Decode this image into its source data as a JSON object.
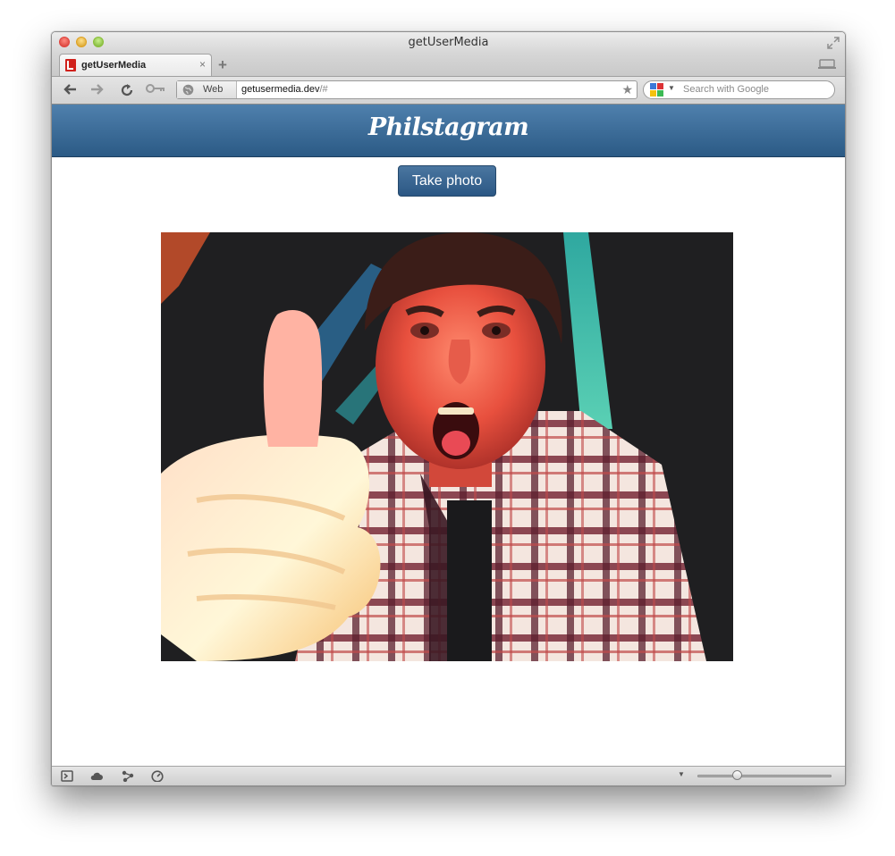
{
  "window": {
    "title": "getUserMedia",
    "traffic_lights": {
      "close_color": "#e0443e",
      "minimize_color": "#dea123",
      "zoom_color": "#8bbf3a"
    },
    "fullscreen_icon": "fullscreen-arrows-icon"
  },
  "tabs": [
    {
      "title": "getUserMedia",
      "favicon": "red-document-favicon",
      "close_glyph": "×"
    }
  ],
  "new_tab_glyph": "+",
  "toolbar": {
    "back_icon": "back-arrow-icon",
    "forward_icon": "forward-arrow-icon",
    "reload_icon": "reload-icon",
    "key_icon": "key-icon",
    "web_label": "Web",
    "url_host": "getusermedia.dev",
    "url_path": "/#",
    "bookmark_icon": "star-icon"
  },
  "search": {
    "placeholder": "Search with Google",
    "engine_icon": "google-icon"
  },
  "page": {
    "app_name": "Philstagram",
    "take_photo_label": "Take photo",
    "photo_icon": "webcam-photo",
    "header_color_top": "#4f80ad",
    "header_color_bottom": "#2b5a85"
  },
  "statusbar": {
    "icons": [
      "console-icon",
      "cloud-icon",
      "share-icon",
      "speedometer-icon"
    ],
    "zoom_level": 0.28
  }
}
